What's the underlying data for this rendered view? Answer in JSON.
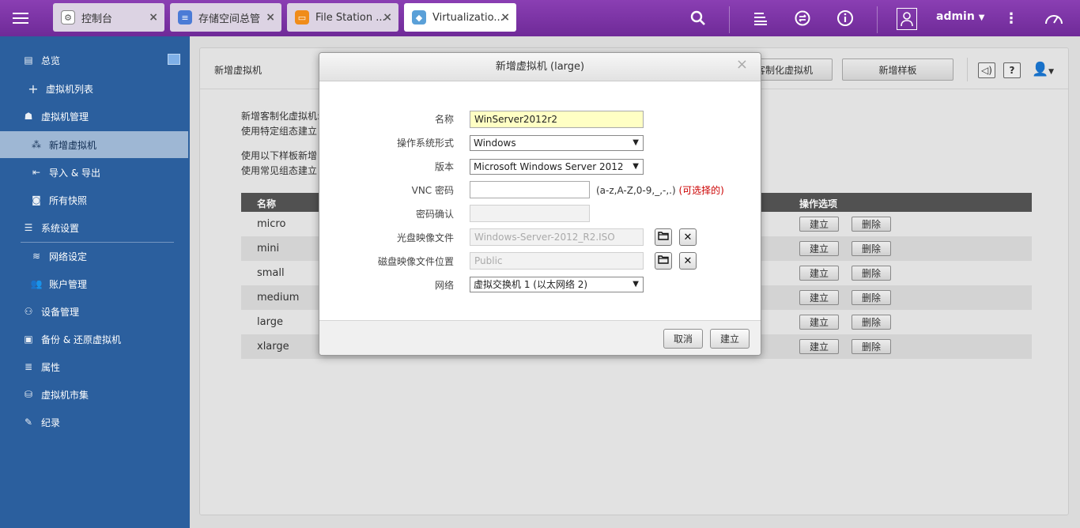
{
  "topbar": {
    "tabs": [
      {
        "label": "控制台",
        "icon": "gear-icon",
        "color": "#8a8a8a"
      },
      {
        "label": "存储空间总管",
        "icon": "database-icon",
        "color": "#4b7bd6"
      },
      {
        "label": "File Station ...",
        "icon": "folder-icon",
        "color": "#f08c1a"
      },
      {
        "label": "Virtualizatio...",
        "icon": "cube-icon",
        "color": "#5aa0d8"
      }
    ],
    "user": "admin"
  },
  "sidebar": {
    "items": [
      {
        "label": "总览"
      },
      {
        "label": "虚拟机列表"
      },
      {
        "label": "虚拟机管理"
      },
      {
        "label": "新增虚拟机"
      },
      {
        "label": "导入 & 导出"
      },
      {
        "label": "所有快照"
      },
      {
        "label": "系统设置"
      },
      {
        "label": "网络设定"
      },
      {
        "label": "账户管理"
      },
      {
        "label": "设备管理"
      },
      {
        "label": "备份 & 还原虚拟机"
      },
      {
        "label": "属性"
      },
      {
        "label": "虚拟机市集"
      },
      {
        "label": "纪录"
      }
    ]
  },
  "main": {
    "title": "新增虚拟机",
    "btn_custom": "客制化虚拟机",
    "btn_template": "新增样板",
    "intro1_title": "新增客制化虚拟机:",
    "intro1_text": "使用特定组态建立",
    "intro2_title": "使用以下样板新增",
    "intro2_text": "使用常见组态建立",
    "table": {
      "col_name": "名称",
      "col_actions": "操作选项",
      "btn_create": "建立",
      "btn_delete": "删除",
      "rows": [
        "micro",
        "mini",
        "small",
        "medium",
        "large",
        "xlarge"
      ]
    }
  },
  "modal": {
    "title": "新增虚拟机 (large)",
    "labels": {
      "name": "名称",
      "os": "操作系统形式",
      "version": "版本",
      "vnc": "VNC 密码",
      "confirm": "密码确认",
      "iso": "光盘映像文件",
      "disk": "磁盘映像文件位置",
      "network": "网络"
    },
    "values": {
      "name": "WinServer2012r2",
      "os": "Windows",
      "version": "Microsoft Windows Server 2012",
      "vnc": "",
      "confirm": "",
      "iso": "Windows-Server-2012_R2.ISO",
      "disk": "Public",
      "network": "虚拟交换机 1 (以太网络 2)"
    },
    "vnc_hint": "(a-z,A-Z,0-9,_,-,.)",
    "vnc_hint_optional": "(可选择的)",
    "cancel": "取消",
    "create": "建立"
  }
}
